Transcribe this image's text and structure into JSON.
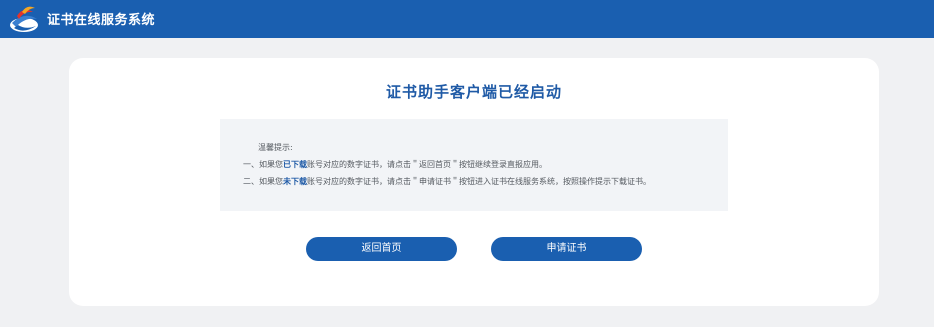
{
  "header": {
    "app_title": "证书在线服务系统",
    "logo_icon": "app-logo-icon",
    "background_color": "#1a5fb0"
  },
  "card": {
    "title": "证书助手客户端已经启动",
    "title_color": "#1f5aa6"
  },
  "tips": {
    "heading": "温馨提示:",
    "line1": {
      "prefix": "一、如果您",
      "emphasis": "已下载",
      "suffix": "账号对应的数字证书，请点击＂返回首页＂按钮继续登录直报应用。"
    },
    "line2": {
      "prefix": "二、如果您",
      "emphasis": "未下载",
      "suffix": "账号对应的数字证书，请点击＂申请证书＂按钮进入证书在线服务系统，按照操作提示下载证书。"
    }
  },
  "buttons": {
    "home_label": "返回首页",
    "apply_label": "申请证书",
    "color": "#1a5fb0"
  }
}
